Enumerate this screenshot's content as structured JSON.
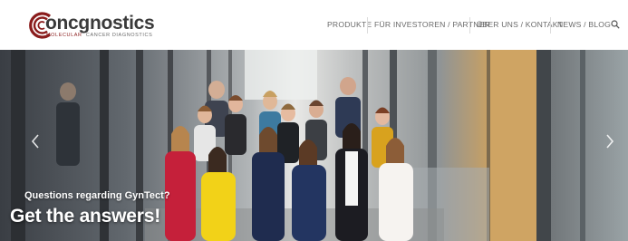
{
  "brand": {
    "name": "oncgnostics",
    "tagline_part1": "MOLECULAR",
    "tagline_part2": "CANCER DIAGNOSTICS",
    "color_red": "#8a1c1c",
    "color_grey": "#3a3a3a"
  },
  "nav": {
    "items": [
      {
        "label": "PRODUKTE"
      },
      {
        "label": "FÜR INVESTOREN / PARTNER"
      },
      {
        "label": "ÜBER UNS / KONTAKT"
      },
      {
        "label": "NEWS / BLOG"
      }
    ],
    "search_icon": "search-icon"
  },
  "hero": {
    "question": "Questions regarding GynTect?",
    "headline": "Get the answers!",
    "prev_icon": "chevron-left-icon",
    "next_icon": "chevron-right-icon",
    "image": "group-photo"
  }
}
